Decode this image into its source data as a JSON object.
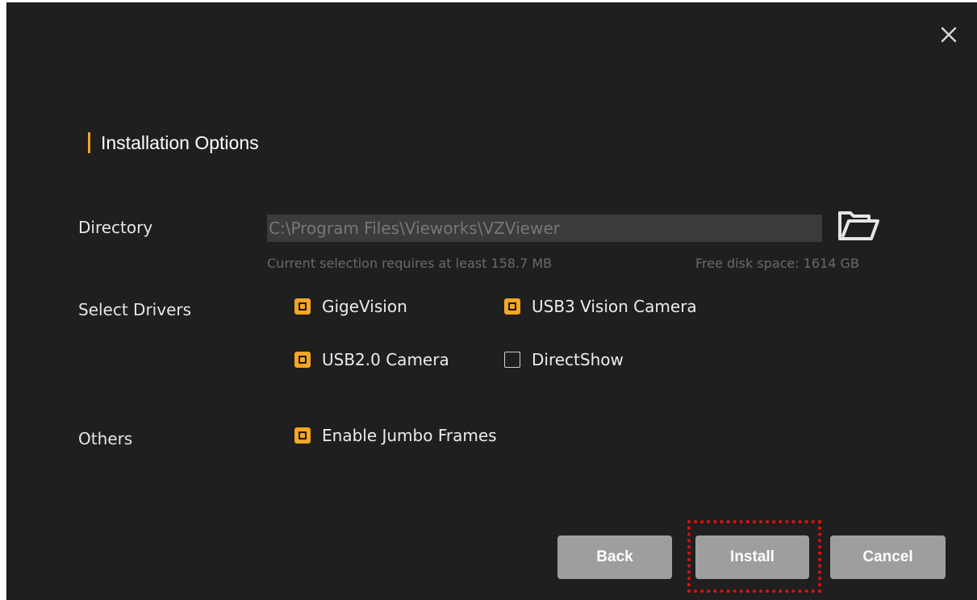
{
  "dialog": {
    "close_icon": "close-icon",
    "section_title": "Installation Options",
    "accent_color": "#f5a623"
  },
  "directory": {
    "label": "Directory",
    "value": "C:\\Program Files\\Vieworks\\VZViewer",
    "folder_icon": "folder-open-icon",
    "required_text": "Current selection requires at least 158.7 MB",
    "free_space_text": "Free disk space: 1614 GB"
  },
  "drivers": {
    "label": "Select Drivers",
    "items": [
      {
        "label": "GigeVision",
        "checked": true
      },
      {
        "label": "USB3 Vision Camera",
        "checked": true
      },
      {
        "label": "USB2.0 Camera",
        "checked": true
      },
      {
        "label": "DirectShow",
        "checked": false
      }
    ]
  },
  "others": {
    "label": "Others",
    "items": [
      {
        "label": "Enable Jumbo Frames",
        "checked": true
      }
    ]
  },
  "buttons": {
    "back": "Back",
    "install": "Install",
    "cancel": "Cancel"
  }
}
